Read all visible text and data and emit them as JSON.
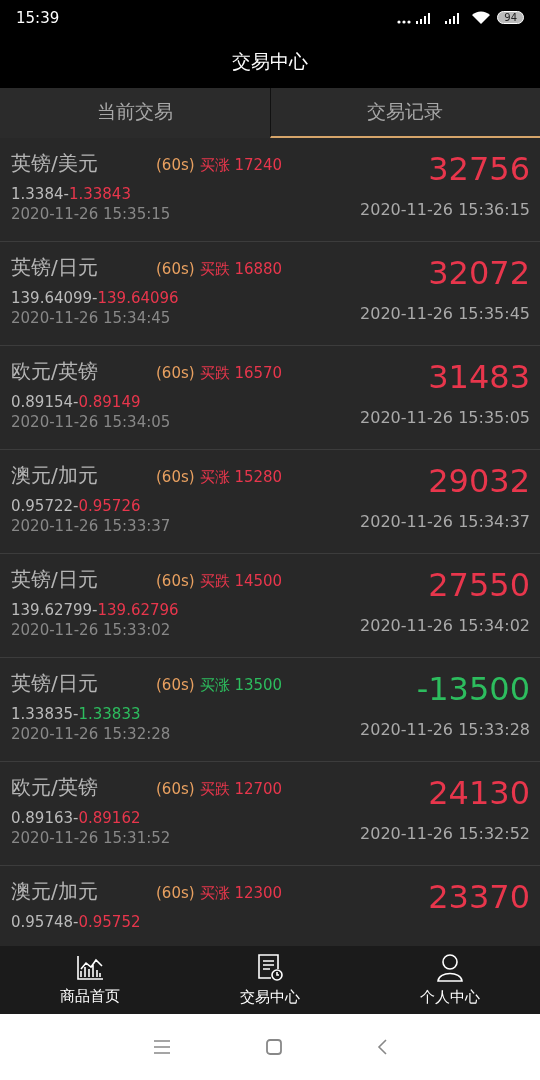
{
  "status_bar": {
    "time": "15:39",
    "battery": "94"
  },
  "header": {
    "title": "交易中心"
  },
  "tabs": [
    {
      "label": "当前交易",
      "selected": false
    },
    {
      "label": "交易记录",
      "selected": true
    }
  ],
  "records": [
    {
      "pair": "英镑/美元",
      "period": "(60s)",
      "direction": "买涨 17240",
      "open": "1.3384-",
      "close": "1.33843",
      "open_time": "2020-11-26 15:35:15",
      "amount": "32756",
      "close_time": "2020-11-26 15:36:15",
      "kind": "profit"
    },
    {
      "pair": "英镑/日元",
      "period": "(60s)",
      "direction": "买跌 16880",
      "open": "139.64099-",
      "close": "139.64096",
      "open_time": "2020-11-26 15:34:45",
      "amount": "32072",
      "close_time": "2020-11-26 15:35:45",
      "kind": "profit"
    },
    {
      "pair": "欧元/英镑",
      "period": "(60s)",
      "direction": "买跌 16570",
      "open": "0.89154-",
      "close": "0.89149",
      "open_time": "2020-11-26 15:34:05",
      "amount": "31483",
      "close_time": "2020-11-26 15:35:05",
      "kind": "profit"
    },
    {
      "pair": "澳元/加元",
      "period": "(60s)",
      "direction": "买涨 15280",
      "open": "0.95722-",
      "close": "0.95726",
      "open_time": "2020-11-26 15:33:37",
      "amount": "29032",
      "close_time": "2020-11-26 15:34:37",
      "kind": "profit"
    },
    {
      "pair": "英镑/日元",
      "period": "(60s)",
      "direction": "买跌 14500",
      "open": "139.62799-",
      "close": "139.62796",
      "open_time": "2020-11-26 15:33:02",
      "amount": "27550",
      "close_time": "2020-11-26 15:34:02",
      "kind": "profit"
    },
    {
      "pair": "英镑/日元",
      "period": "(60s)",
      "direction": "买涨 13500",
      "open": "1.33835-",
      "close": "1.33833",
      "open_time": "2020-11-26 15:32:28",
      "amount": "-13500",
      "close_time": "2020-11-26 15:33:28",
      "kind": "loss"
    },
    {
      "pair": "欧元/英镑",
      "period": "(60s)",
      "direction": "买跌 12700",
      "open": "0.89163-",
      "close": "0.89162",
      "open_time": "2020-11-26 15:31:52",
      "amount": "24130",
      "close_time": "2020-11-26 15:32:52",
      "kind": "profit"
    },
    {
      "pair": "澳元/加元",
      "period": "(60s)",
      "direction": "买涨 12300",
      "open": "0.95748-",
      "close": "0.95752",
      "amount": "23370",
      "kind": "profit"
    }
  ],
  "bottom_nav": [
    {
      "label": "商品首页",
      "kind": "chart"
    },
    {
      "label": "交易中心",
      "kind": "document"
    },
    {
      "label": "个人中心",
      "kind": "person"
    }
  ]
}
